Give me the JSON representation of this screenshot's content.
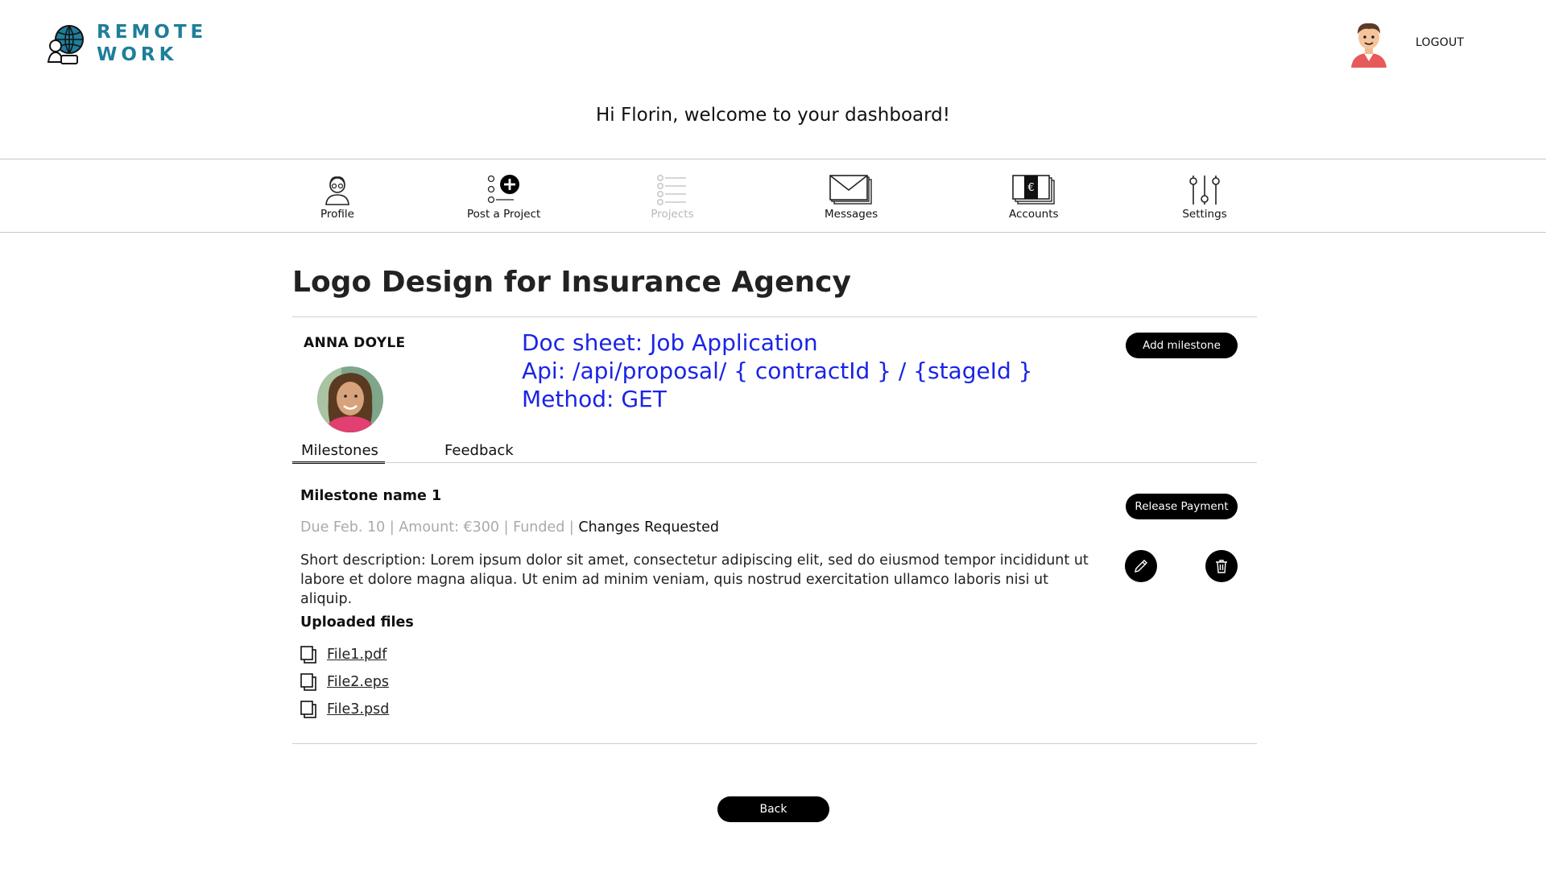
{
  "header": {
    "logo_line1": "REMOTE",
    "logo_line2": "WORK",
    "logout_label": "LOGOUT",
    "welcome": "Hi Florin, welcome to your dashboard!"
  },
  "nav": {
    "items": [
      {
        "label": "Profile",
        "icon": "profile-icon",
        "active": true
      },
      {
        "label": "Post a Project",
        "icon": "post-project-icon",
        "active": true
      },
      {
        "label": "Projects",
        "icon": "projects-list-icon",
        "active": false
      },
      {
        "label": "Messages",
        "icon": "envelope-icon",
        "active": true
      },
      {
        "label": "Accounts",
        "icon": "euro-bills-icon",
        "active": true
      },
      {
        "label": "Settings",
        "icon": "sliders-icon",
        "active": true
      }
    ]
  },
  "project": {
    "title": "Logo Design for Insurance Agency",
    "freelancer_name": "ANNA DOYLE",
    "doc_note": {
      "line1": "Doc sheet: Job Application",
      "line2": "Api: /api/proposal/ { contractId } / {stageId }",
      "line3": "Method: GET"
    },
    "add_milestone_label": "Add milestone"
  },
  "tabs": [
    {
      "label": "Milestones",
      "selected": true
    },
    {
      "label": "Feedback",
      "selected": false
    }
  ],
  "milestone": {
    "name": "Milestone name 1",
    "meta": "Due Feb. 10 | Amount: €300 | Funded | ",
    "status": "Changes Requested",
    "description": "Short description:  Lorem ipsum dolor sit amet, consectetur adipiscing elit, sed do eiusmod tempor incididunt ut labore et dolore magna aliqua. Ut enim ad minim veniam, quis nostrud exercitation ullamco laboris nisi ut aliquip.",
    "release_payment_label": "Release Payment"
  },
  "uploaded": {
    "title": "Uploaded files",
    "files": [
      "File1.pdf",
      "File2.eps",
      "File3.psd"
    ]
  },
  "back_label": "Back",
  "colors": {
    "brand": "#1e7f9a",
    "doc_note": "#1a24e6",
    "button": "#000000",
    "muted": "#aaaaaa",
    "dim_nav": "#b8b8b8"
  }
}
